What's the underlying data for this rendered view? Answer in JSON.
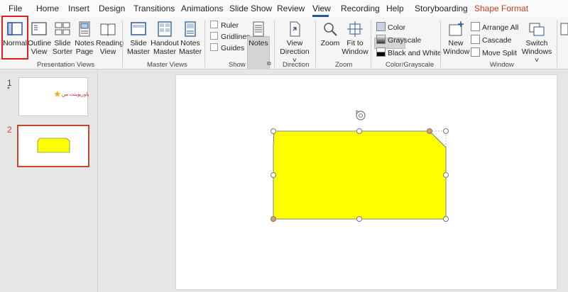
{
  "menu": {
    "tabs": [
      "File",
      "Home",
      "Insert",
      "Design",
      "Transitions",
      "Animations",
      "Slide Show",
      "Review",
      "View",
      "Recording",
      "Help",
      "Storyboarding",
      "Shape Format"
    ],
    "active": "View"
  },
  "ribbon": {
    "presentation_views": {
      "normal": "Normal",
      "outline": [
        "Outline",
        "View"
      ],
      "slide_sorter": [
        "Slide",
        "Sorter"
      ],
      "notes_page": [
        "Notes",
        "Page"
      ],
      "reading": [
        "Reading",
        "View"
      ],
      "label": "Presentation Views"
    },
    "master_views": {
      "slide_master": [
        "Slide",
        "Master"
      ],
      "handout_master": [
        "Handout",
        "Master"
      ],
      "notes_master": [
        "Notes",
        "Master"
      ],
      "label": "Master Views"
    },
    "show": {
      "ruler": "Ruler",
      "gridlines": "Gridlines",
      "guides": "Guides",
      "notes": "Notes",
      "label": "Show"
    },
    "direction": {
      "view_direction": [
        "View",
        "Direction"
      ],
      "label": "Direction"
    },
    "zoom": {
      "zoom": "Zoom",
      "fit": [
        "Fit to",
        "Window"
      ],
      "label": "Zoom"
    },
    "color": {
      "color": "Color",
      "grayscale": "Grayscale",
      "bw": "Black and White",
      "label": "Color/Grayscale"
    },
    "window": {
      "new_window": [
        "New",
        "Window"
      ],
      "arrange_all": "Arrange All",
      "cascade": "Cascade",
      "move_split": "Move Split",
      "switch": [
        "Switch",
        "Windows"
      ],
      "label": "Window"
    }
  },
  "slides": {
    "items": [
      {
        "number": "1",
        "star": "*",
        "title_text": "پاورپوینت من"
      },
      {
        "number": "2"
      }
    ]
  },
  "colors": {
    "shape_fill": "#ffff00",
    "accent": "#2b579a",
    "selection": "#c4472f",
    "highlight": "#e0201f"
  }
}
